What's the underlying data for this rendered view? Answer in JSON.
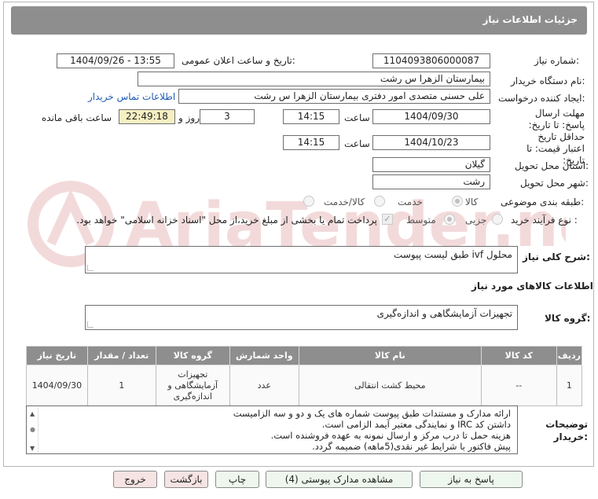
{
  "header": {
    "title": "جزئیات اطلاعات نیاز"
  },
  "fields": {
    "need_number_label": "شماره نیاز:",
    "need_number": "1104093806000087",
    "announce_label": "تاریخ و ساعت اعلان عمومی:",
    "announce_value": "1404/09/26 - 13:55",
    "buyer_org_label": "نام دستگاه خریدار:",
    "buyer_org": "بیمارستان الزهرا  س  رشت",
    "requester_label": "ایجاد کننده درخواست:",
    "requester": "علی حسنی متصدی امور دفتری بیمارستان الزهرا  س  رشت",
    "contact_link": "اطلاعات تماس خریدار",
    "send_deadline_label": "مهلت ارسال پاسخ: تا تاریخ:",
    "send_date": "1404/09/30",
    "time_label": "ساعت",
    "send_time": "14:15",
    "days": "3",
    "days_label": "روز و",
    "remaining": "22:49:18",
    "remaining_label": "ساعت باقی مانده",
    "validity_label": "حداقل تاریخ اعتبار قیمت: تا تاریخ:",
    "validity_date": "1404/10/23",
    "validity_time": "14:15",
    "province_label": "استان محل تحویل:",
    "province": "گیلان",
    "city_label": "شهر محل تحویل:",
    "city": "رشت",
    "category_label": "طبقه بندی موضوعی:",
    "category_options": [
      "کالا",
      "خدمت",
      "کالا/خدمت"
    ],
    "process_label": "نوع فرآیند خرید :",
    "process_options": [
      "جزیی",
      "متوسط"
    ],
    "payment_note": "پرداخت تمام یا بخشی از مبلغ خرید،از محل \"اسناد خزانه اسلامی\" خواهد بود."
  },
  "summary": {
    "label": "شرح کلی نیاز:",
    "value": "محلول ivf طبق لیست پیوست"
  },
  "goods_section": {
    "title": "اطلاعات کالاهای مورد نیاز"
  },
  "goods_group": {
    "label": "گروه کالا:",
    "value": "تجهیزات آزمایشگاهی و اندازه‌گیری"
  },
  "table": {
    "headers": [
      "ردیف",
      "کد کالا",
      "نام کالا",
      "واحد شمارش",
      "گروه کالا",
      "تعداد / مقدار",
      "تاریخ نیاز"
    ],
    "rows": [
      [
        "1",
        "--",
        "محیط کشت انتقالی",
        "عدد",
        "تجهیزات آزمایشگاهی و اندازه‌گیری",
        "1",
        "1404/09/30"
      ]
    ]
  },
  "notes": {
    "label": "توضیحات خریدار:",
    "lines": [
      "ارائه مدارک و مستندات طبق پیوست شماره های یک و دو و سه الزامیست",
      "داشتن کد IRC و نمایندگی معتبر آیمد الزامی است.",
      "هزینه حمل تا درب مرکز و ارسال نمونه به عهده فروشنده است.",
      "پیش فاکتور با شرایط غیر نقدی(5ماهه) ضمیمه گردد."
    ]
  },
  "buttons": {
    "reply": "پاسخ به نیاز",
    "attachments": "مشاهده مدارک پیوستی (4)",
    "print": "چاپ",
    "back": "بازگشت",
    "exit": "خروج"
  },
  "watermark": {
    "text": "AriaTender.net"
  },
  "colors": {
    "header_bg": "#8e8e8e",
    "link": "#1f5bb5",
    "remaining_bg": "#f5efc2",
    "button_bg": "#eef7ee",
    "exit_bg": "#f6e3e3"
  }
}
